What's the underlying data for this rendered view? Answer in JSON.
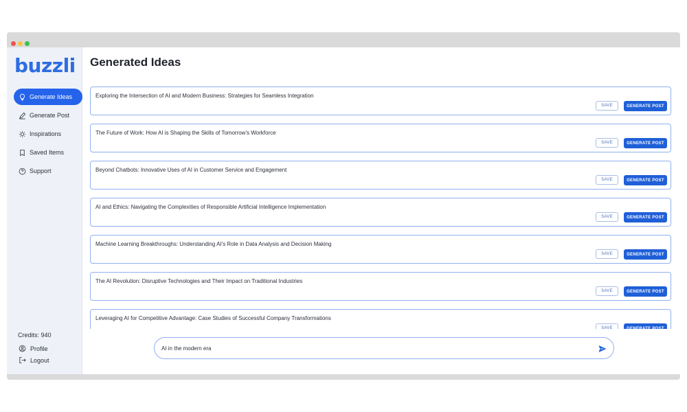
{
  "app": {
    "logo_text": "buzzli",
    "brand_color": "#2563eb"
  },
  "sidebar": {
    "items": [
      {
        "label": "Generate Ideas",
        "icon": "lightbulb-icon",
        "active": true
      },
      {
        "label": "Generate Post",
        "icon": "pencil-icon",
        "active": false
      },
      {
        "label": "Inspirations",
        "icon": "sparkle-bulb-icon",
        "active": false
      },
      {
        "label": "Saved Items",
        "icon": "bookmark-icon",
        "active": false
      },
      {
        "label": "Support",
        "icon": "help-circle-icon",
        "active": false
      }
    ],
    "credits": "Credits: 940",
    "profile_label": "Profile",
    "logout_label": "Logout"
  },
  "main": {
    "title": "Generated Ideas",
    "save_label": "SAVE",
    "generate_label": "GENERATE POST",
    "ideas": [
      "Exploring the Intersection of AI and Modern Business: Strategies for Seamless Integration",
      "The Future of Work: How AI is Shaping the Skills of Tomorrow's Workforce",
      "Beyond Chatbots: Innovative Uses of AI in Customer Service and Engagement",
      "AI and Ethics: Navigating the Complexities of Responsible Artificial Intelligence Implementation",
      "Machine Learning Breakthroughs: Understanding AI's Role in Data Analysis and Decision Making",
      "The AI Revolution: Disruptive Technologies and Their Impact on Traditional Industries",
      "Leveraging AI for Competitive Advantage: Case Studies of Successful Company Transformations"
    ]
  },
  "prompt": {
    "value": "AI in the modern era"
  }
}
